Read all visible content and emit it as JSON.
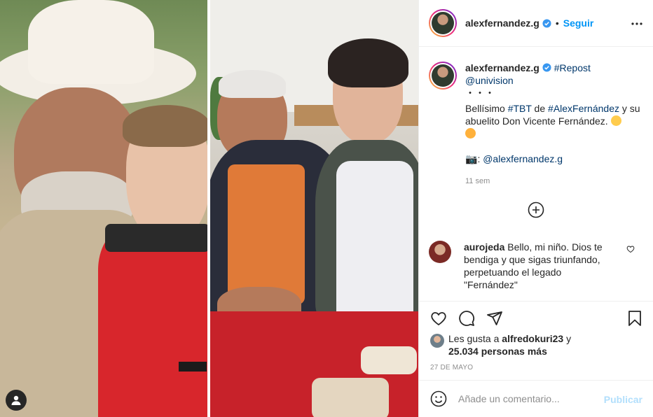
{
  "header": {
    "username": "alexfernandez.g",
    "separator": "•",
    "follow_label": "Seguir"
  },
  "caption": {
    "username": "alexfernandez.g",
    "tag_repost": "#Repost",
    "mention_univision": "@univision",
    "dots": "・・・",
    "line_prefix": "Bellísimo ",
    "tag_tbt": "#TBT",
    "word_de": " de ",
    "tag_alex": "#AlexFernández",
    "line_suffix": " y su abuelito Don Vicente Fernández.",
    "camera_emoji": "📷",
    "mention_alex": "@alexfernandez.g",
    "time": "11 sem"
  },
  "comment": {
    "username": "aurojeda",
    "text": "Bello, mi niño. Dios te bendiga y que sigas triunfando, perpetuando el legado \"Fernández\""
  },
  "likes": {
    "prefix": "Les gusta a ",
    "user": "alfredokuri23",
    "middle": " y",
    "count": "25.034 personas más"
  },
  "date": "27 DE MAYO",
  "add_comment": {
    "placeholder": "Añade un comentario...",
    "post_label": "Publicar"
  },
  "icons": {
    "heart": "heart-icon",
    "comment": "comment-icon",
    "share": "paper-plane-icon",
    "save": "bookmark-icon",
    "emoji": "smile-icon",
    "more": "ellipsis-icon",
    "load_more": "plus-circle-icon",
    "tag": "user-tag-icon"
  },
  "colors": {
    "accent": "#0095f6",
    "link": "#00376b",
    "muted": "#8e8e8e",
    "post_disabled": "#b2dffc"
  }
}
